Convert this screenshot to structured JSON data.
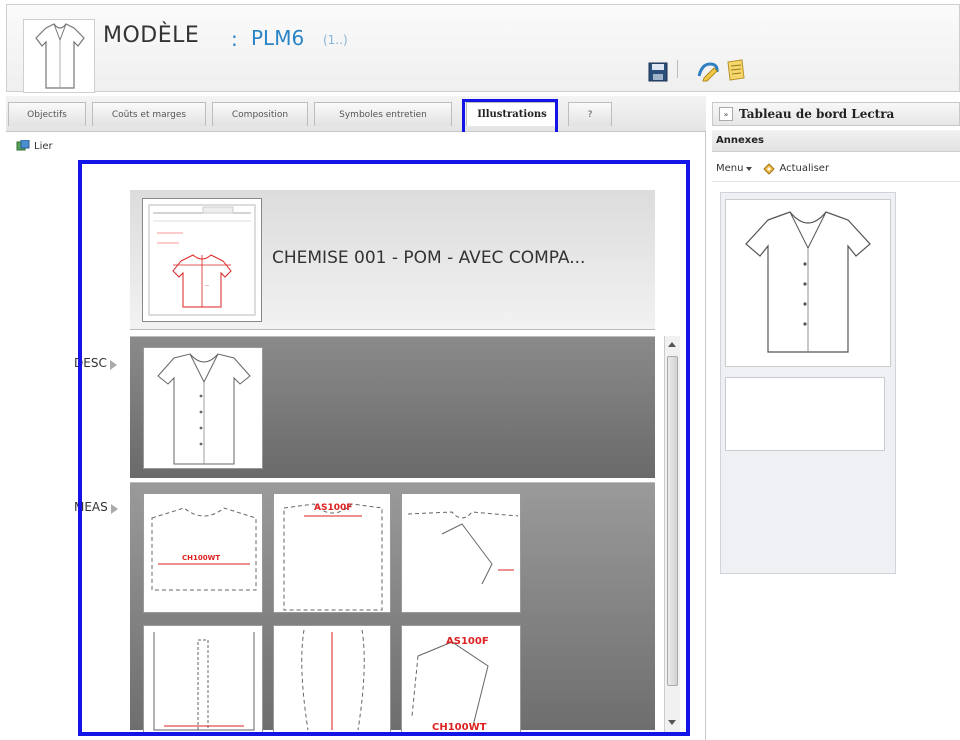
{
  "header": {
    "title": "MODÈLE",
    "separator": ":",
    "code": "PLM6",
    "version": "(1..)",
    "icons": [
      "garment-thumbnail-icon",
      "save-icon",
      "edit-icon",
      "notes-icon"
    ]
  },
  "tabs": [
    {
      "label": "Objectifs",
      "active": false
    },
    {
      "label": "Coûts et marges",
      "active": false
    },
    {
      "label": "Composition",
      "active": false
    },
    {
      "label": "Symboles entretien",
      "active": false
    },
    {
      "label": "Illustrations",
      "active": true
    },
    {
      "label": "?",
      "active": false
    }
  ],
  "left_panel": {
    "lier_label": "Lier",
    "top_card_title": "CHEMISE 001 - POM - AVEC COMPA...",
    "sections": [
      {
        "label": "DESC"
      },
      {
        "label": "MEAS"
      }
    ],
    "meas_tile_labels": [
      "CH100WT",
      "AS100F",
      "",
      "",
      "",
      "AS100F",
      "CH100WT"
    ]
  },
  "right_panel": {
    "title": "Tableau de bord Lectra",
    "annexes_label": "Annexes",
    "menu_label": "Menu",
    "refresh_label": "Actualiser"
  },
  "colors": {
    "highlight": "#1414e6",
    "title_accent": "#2a84c6",
    "section_gray": "#7a7a7a"
  }
}
